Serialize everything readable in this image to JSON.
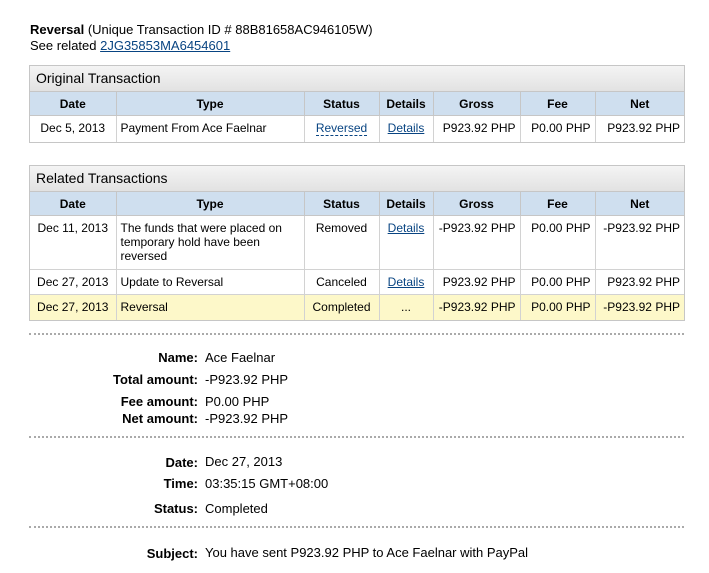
{
  "header": {
    "title_strong": "Reversal",
    "title_rest": " (Unique Transaction ID # 88B81658AC946105W)",
    "see_related_label": "See related ",
    "related_id": "2JG35853MA6454601"
  },
  "columns": [
    "Date",
    "Type",
    "Status",
    "Details",
    "Gross",
    "Fee",
    "Net"
  ],
  "original": {
    "title": "Original Transaction",
    "rows": [
      {
        "date": "Dec 5, 2013",
        "type": "Payment From Ace Faelnar",
        "status": "Reversed",
        "details": "Details",
        "gross": "P923.92 PHP",
        "fee": "P0.00 PHP",
        "net": "P923.92 PHP"
      }
    ]
  },
  "related": {
    "title": "Related Transactions",
    "rows": [
      {
        "date": "Dec 11, 2013",
        "type": "The funds that were placed on temporary hold have been reversed",
        "status": "Removed",
        "details": "Details",
        "gross": "-P923.92 PHP",
        "fee": "P0.00 PHP",
        "net": "-P923.92 PHP"
      },
      {
        "date": "Dec 27, 2013",
        "type": "Update to Reversal",
        "status": "Canceled",
        "details": "Details",
        "gross": "P923.92 PHP",
        "fee": "P0.00 PHP",
        "net": "P923.92 PHP"
      },
      {
        "date": "Dec 27, 2013",
        "type": "Reversal",
        "status": "Completed",
        "details": "...",
        "gross": "-P923.92 PHP",
        "fee": "P0.00 PHP",
        "net": "-P923.92 PHP"
      }
    ]
  },
  "summary": {
    "name_label": "Name:",
    "name": "Ace Faelnar",
    "total_label": "Total amount:",
    "total": "-P923.92 PHP",
    "fee_label": "Fee amount:",
    "fee": "P0.00 PHP",
    "net_label": "Net amount:",
    "net": "-P923.92 PHP",
    "date_label": "Date:",
    "date": "Dec 27, 2013",
    "time_label": "Time:",
    "time": "03:35:15 GMT+08:00",
    "status_label": "Status:",
    "status": "Completed",
    "subject_label": "Subject:",
    "subject": "You have sent P923.92 PHP to Ace Faelnar with PayPal"
  }
}
